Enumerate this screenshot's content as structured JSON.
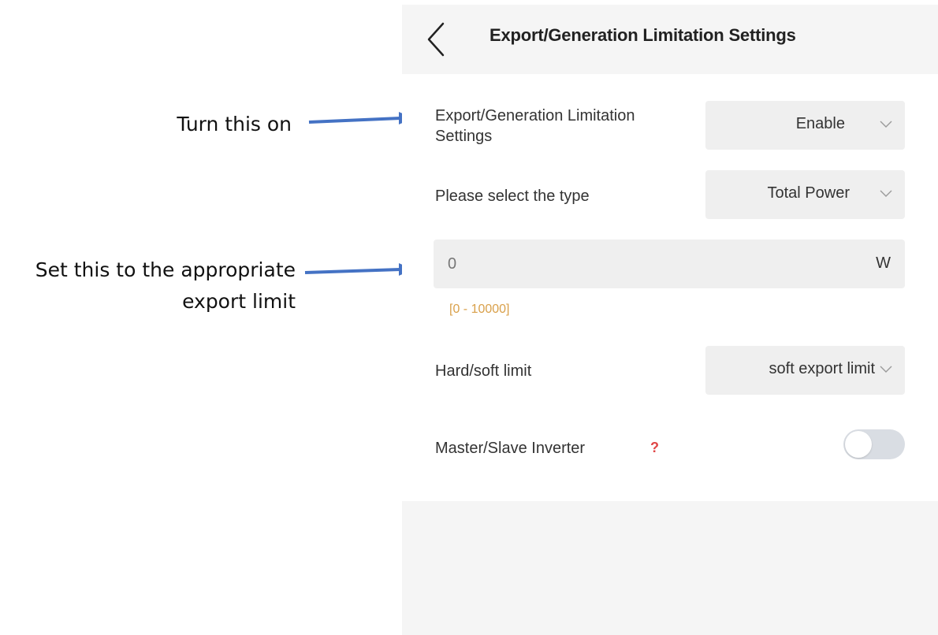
{
  "annotations": {
    "turn_on": "Turn this on",
    "set_limit_line1": "Set this to the appropriate",
    "set_limit_line2": "export limit"
  },
  "header": {
    "title": "Export/Generation Limitation Settings"
  },
  "settings": {
    "limitation": {
      "label_line1": "Export/Generation Limitation",
      "label_line2": "Settings",
      "value": "Enable"
    },
    "type": {
      "label": "Please select the type",
      "value": "Total Power"
    },
    "power": {
      "value": "0",
      "unit": "W",
      "range": "[0 - 10000]"
    },
    "limit_mode": {
      "label": "Hard/soft limit",
      "value": "soft export limit"
    },
    "master_slave": {
      "label": "Master/Slave Inverter",
      "help": "?",
      "enabled": false
    }
  },
  "colors": {
    "arrow": "#4472c4",
    "range_text": "#d9a04a",
    "help_mark": "#e04646"
  }
}
